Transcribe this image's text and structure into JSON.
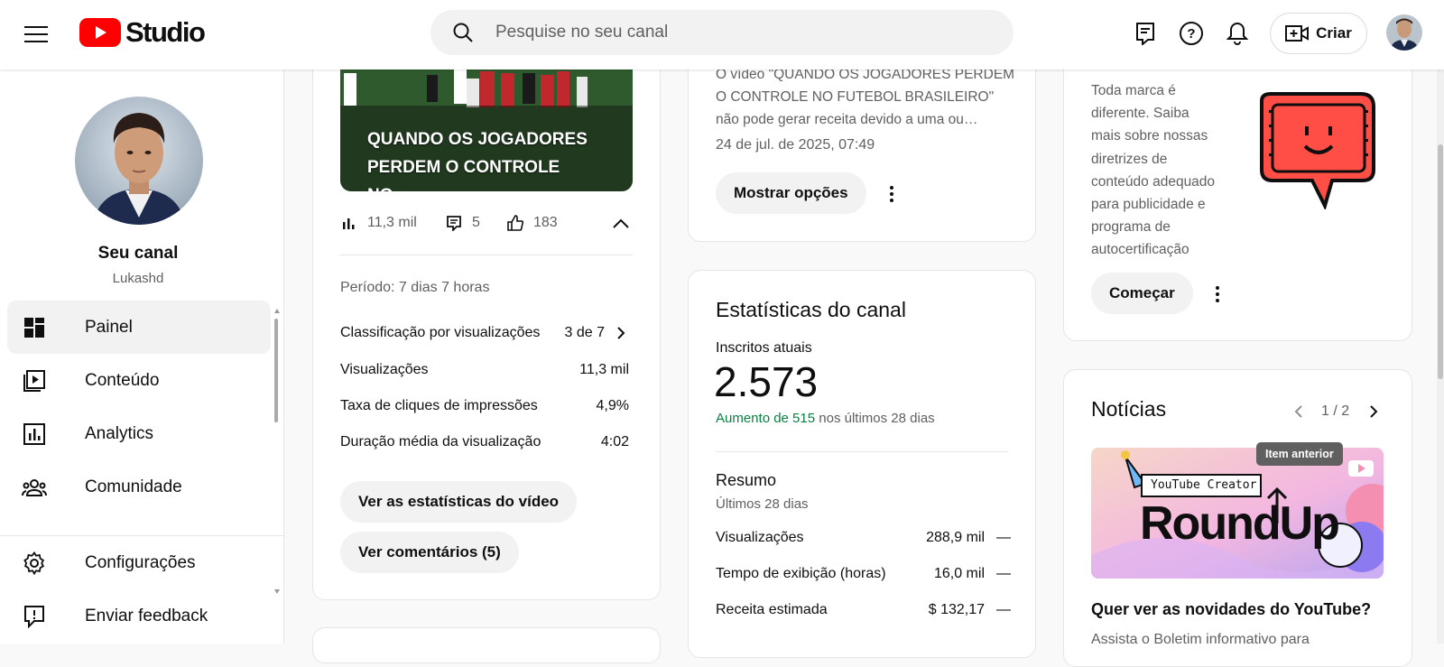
{
  "header": {
    "logo_text": "Studio",
    "search_placeholder": "Pesquise no seu canal",
    "create_label": "Criar"
  },
  "sidebar": {
    "channel_title": "Seu canal",
    "channel_handle": "Lukashd",
    "nav": [
      {
        "label": "Painel",
        "icon": "dashboard-icon",
        "active": true
      },
      {
        "label": "Conteúdo",
        "icon": "content-icon"
      },
      {
        "label": "Analytics",
        "icon": "analytics-icon"
      },
      {
        "label": "Comunidade",
        "icon": "community-icon"
      }
    ],
    "bottom": [
      {
        "label": "Configurações",
        "icon": "gear-icon"
      },
      {
        "label": "Enviar feedback",
        "icon": "feedback-icon"
      }
    ]
  },
  "latest_video": {
    "thumb_title": "QUANDO OS JOGADORES PERDEM O CONTROLE NO…",
    "views": "11,3 mil",
    "comments": "5",
    "likes": "183",
    "period": "Período: 7 dias 7 horas",
    "rows": [
      {
        "label": "Classificação por visualizações",
        "value": "3 de 7"
      },
      {
        "label": "Visualizações",
        "value": "11,3 mil"
      },
      {
        "label": "Taxa de cliques de impressões",
        "value": "4,9%"
      },
      {
        "label": "Duração média da visualização",
        "value": "4:02"
      }
    ],
    "stats_button": "Ver as estatísticas do vídeo",
    "comments_button": "Ver comentários (5)"
  },
  "monetization": {
    "message": "O vídeo \"QUANDO OS JOGADORES PERDEM O CONTROLE NO FUTEBOL BRASILEIRO\" não pode gerar receita devido a uma ou…",
    "line1": "O vídeo \"QUANDO OS JOGADORES PERDEM",
    "line2": "O CONTROLE NO FUTEBOL BRASILEIRO\"",
    "line3": "não pode gerar receita devido a uma ou…",
    "date": "24 de jul. de 2025, 07:49",
    "options_button": "Mostrar opções"
  },
  "channel_stats": {
    "title": "Estatísticas do canal",
    "subs_label": "Inscritos atuais",
    "subs_value": "2.573",
    "growth_highlight": "Aumento de 515",
    "growth_rest": "nos últimos 28 dias",
    "summary_title": "Resumo",
    "summary_period": "Últimos 28 dias",
    "rows": [
      {
        "label": "Visualizações",
        "value": "288,9 mil",
        "trend": "—"
      },
      {
        "label": "Tempo de exibição (horas)",
        "value": "16,0 mil",
        "trend": "—"
      },
      {
        "label": "Receita estimada",
        "value": "$ 132,17",
        "trend": "—"
      }
    ],
    "growth_color": "#0b8043"
  },
  "ad_friendly": {
    "lines": [
      "Toda marca é",
      "diferente. Saiba",
      "mais sobre nossas",
      "diretrizes de",
      "conteúdo adequado",
      "para publicidade e",
      "programa de",
      "autocertificação"
    ],
    "start_button": "Começar"
  },
  "news": {
    "title": "Notícias",
    "pager": "1 / 2",
    "tooltip": "Item anterior",
    "banner_tag": "YouTube Creator",
    "banner_title": "RoundUp",
    "headline": "Quer ver as novidades do YouTube?",
    "body": "Assista o Boletim informativo para"
  },
  "colors": {
    "brand_red": "#ff0000",
    "link_green": "#0b8043"
  }
}
